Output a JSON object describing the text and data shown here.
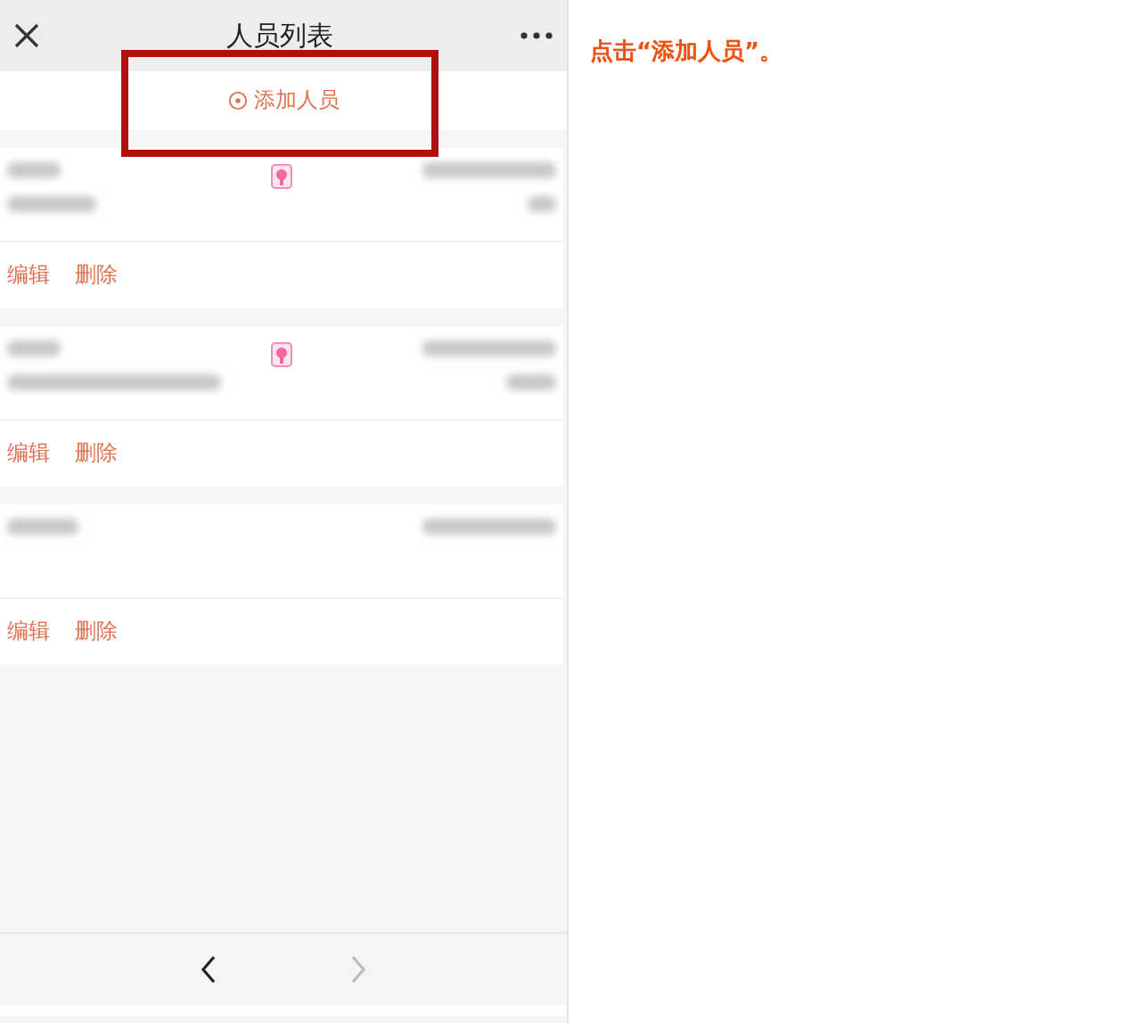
{
  "header": {
    "title": "人员列表"
  },
  "add_button": {
    "label": "添加人员",
    "highlighted": true
  },
  "people": [
    {
      "kind": "two-line",
      "tagged": true,
      "actions": [
        "编辑",
        "删除"
      ]
    },
    {
      "kind": "two-line",
      "tagged": true,
      "actions": [
        "编辑",
        "删除"
      ]
    },
    {
      "kind": "one-line",
      "tagged": false,
      "actions": [
        "编辑",
        "删除"
      ]
    }
  ],
  "nav": {
    "back": {
      "disabled": false
    },
    "forward": {
      "disabled": true
    }
  },
  "instruction": "点击“添加人员”。"
}
